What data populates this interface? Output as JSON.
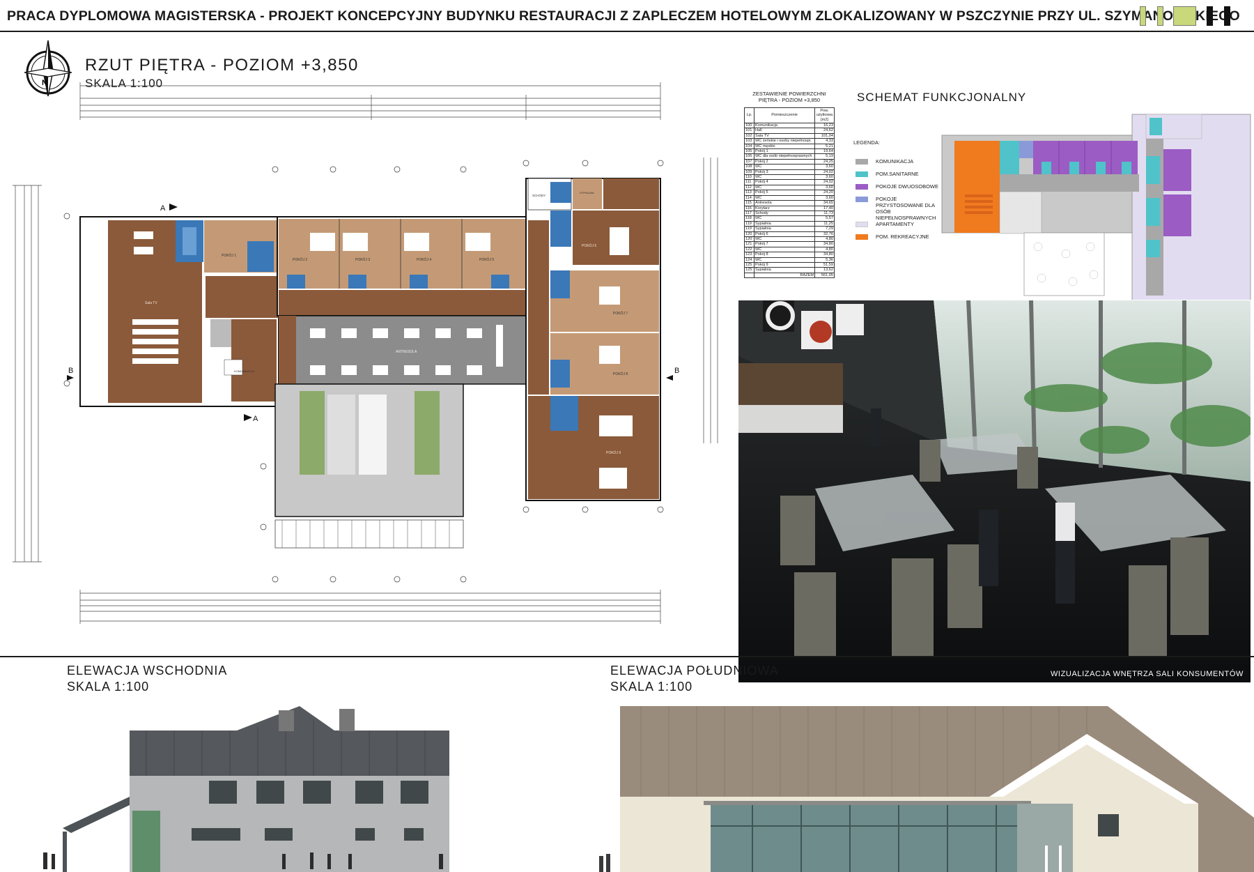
{
  "header": {
    "title": "PRACA DYPLOMOWA MAGISTERSKA - PROJEKT KONCEPCYJNY BUDYNKU RESTAURACJI Z ZAPLECZEM HOTELOWYM ZLOKALIZOWANY W  PSZCZYNIE PRZY UL. SZYMANOWSKIEGO"
  },
  "floor_plan": {
    "title": "RZUT PIĘTRA - POZIOM +3,850",
    "scale": "SKALA 1:100",
    "compass_letter": "N",
    "section_labels": [
      "A",
      "A",
      "B",
      "B"
    ],
    "room_labels": {
      "sala_tv": "Sala TV",
      "komunikacja": "KOMUNIKACJA",
      "schody": "SCHODY",
      "pokoj1": "POKÓJ 1",
      "pokoj2": "POKÓJ 2",
      "pokoj3": "POKÓJ 3",
      "pokoj4": "POKÓJ 4",
      "pokoj5": "POKÓJ 5",
      "pokoj6": "POKÓJ 6",
      "pokoj7": "POKÓJ 7",
      "pokoj8": "POKÓJ 8",
      "pokoj9": "POKÓJ 9",
      "sypialnia": "SYPIALNIA",
      "antresola": "ANTRESOLA"
    }
  },
  "area_table": {
    "caption_line1": "ZESTAWIENIE POWIERZCHNI",
    "caption_line2": "PIĘTRA - POZIOM +3,850",
    "headers": [
      "Lp.",
      "Pomieszczenie",
      "Pow. użytkowa [m2]"
    ],
    "rows": [
      [
        "100",
        "Komunikacja",
        "16,23"
      ],
      [
        "101",
        "Hall",
        "24,62"
      ],
      [
        "102",
        "Sala TV",
        "101,04"
      ],
      [
        "103",
        "WC żeńskie i osoby niepełnospr.",
        "4,33"
      ],
      [
        "104",
        "WC męskie",
        "5,21"
      ],
      [
        "105",
        "Pokój 1",
        "19,64"
      ],
      [
        "106",
        "WC dla osób niepełnosprawnych",
        "5,19"
      ],
      [
        "107",
        "Pokój 2",
        "24,25"
      ],
      [
        "108",
        "WC",
        "3,60"
      ],
      [
        "109",
        "Pokój 3",
        "24,02"
      ],
      [
        "110",
        "WC",
        "3,60"
      ],
      [
        "111",
        "Pokój 4",
        "24,02"
      ],
      [
        "112",
        "WC",
        "3,60"
      ],
      [
        "113",
        "Pokój 5",
        "24,20"
      ],
      [
        "114",
        "WC",
        "3,60"
      ],
      [
        "115",
        "Antresola",
        "34,65"
      ],
      [
        "116",
        "Korytarz",
        "17,40"
      ],
      [
        "117",
        "Schody",
        "11,73"
      ],
      [
        "118",
        "WC",
        "5,57"
      ],
      [
        "119",
        "Sypialnia",
        "11,25"
      ],
      [
        "119'",
        "Sypialnia",
        "7,29"
      ],
      [
        "120",
        "Pokój 6",
        "32,76"
      ],
      [
        "120'",
        "WC",
        "4,80"
      ],
      [
        "121",
        "Pokój 7",
        "34,80"
      ],
      [
        "122",
        "WC",
        "4,80"
      ],
      [
        "123",
        "Pokój 8",
        "34,80"
      ],
      [
        "124",
        "WC",
        "5,36"
      ],
      [
        "125",
        "Pokój 9",
        "51,59"
      ],
      [
        "125'",
        "Sypialnia",
        "13,62"
      ]
    ],
    "total_label": "RAZEM",
    "total_value": "561,05"
  },
  "schema": {
    "title": "SCHEMAT FUNKCJONALNY",
    "legend_title": "LEGENDA:",
    "legend": [
      {
        "label": "KOMUNIKACJA",
        "color": "#a8a8a8"
      },
      {
        "label": "POM.SANITARNE",
        "color": "#4fc3c9"
      },
      {
        "label": "POKOJE DWUOSOBOWE",
        "color": "#9b5cc4"
      },
      {
        "label": "POKOJE PRZYSTOSOWANE DLA OSÓB NIEPEŁNOSPRAWNYCH",
        "color": "#8a9ad8"
      },
      {
        "label": "APARTAMENTY",
        "color": "#e2dcf0"
      },
      {
        "label": "POM. REKREACYJNE",
        "color": "#f07a1e"
      }
    ]
  },
  "render": {
    "caption": "WIZUALIZACJA WNĘTRZA SALI KONSUMENTÓW"
  },
  "elevations": {
    "east_title": "ELEWACJA WSCHODNIA",
    "east_scale": "SKALA 1:100",
    "south_title": "ELEWACJA POŁUDNIOWA",
    "south_scale": "SKALA 1:100"
  },
  "colors": {
    "wood": "#8b5a3a",
    "wood_light": "#c49a76",
    "tile_blue": "#3a78b8",
    "concrete": "#8c8c8c",
    "garden_green": "#8caa6a",
    "wall_grey": "#b5b7b9",
    "roof_dark": "#55585c",
    "roof_beige": "#9a8c7c",
    "wall_cream": "#ece6d6",
    "glass": "#6f8c8c"
  }
}
